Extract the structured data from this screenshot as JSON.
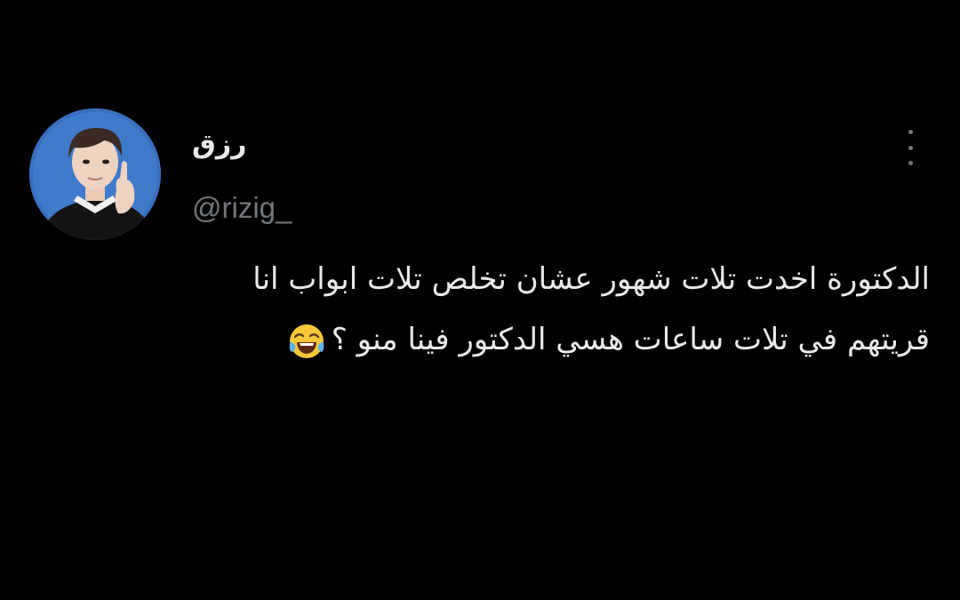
{
  "tweet": {
    "author": {
      "display_name": "رزق",
      "handle": "@rizig_",
      "avatar": "user-avatar-photo"
    },
    "more_icon": "more-options-icon",
    "text_lines": [
      "الدكتورة اخدت تلات شهور عشان تخلص تلات ابواب انا",
      "قريتهم في تلات ساعات هسي الدكتور فينا منو ؟"
    ],
    "emoji": "😂"
  },
  "colors": {
    "background": "#000000",
    "text": "#e7e9ea",
    "secondary_text": "#71767b",
    "avatar_background": "#3a6fbf"
  }
}
